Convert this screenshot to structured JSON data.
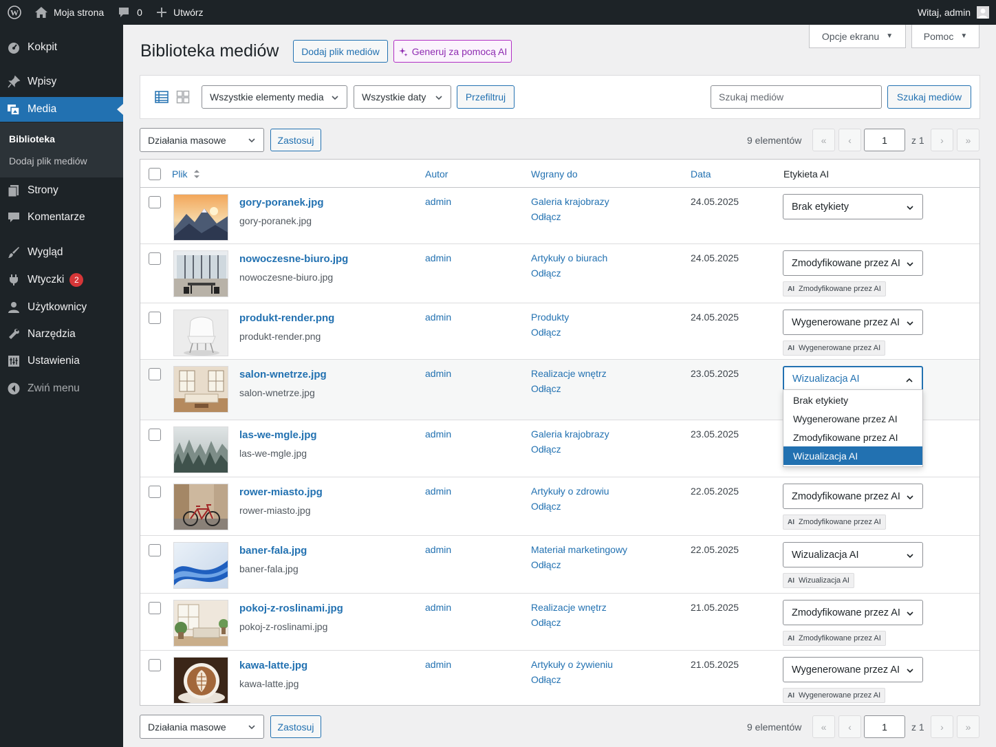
{
  "adminbar": {
    "site_name": "Moja strona",
    "comments_count": "0",
    "new_label": "Utwórz",
    "greeting": "Witaj, admin"
  },
  "sidebar": {
    "items": [
      {
        "label": "Kokpit",
        "icon": "dashboard-icon"
      },
      {
        "label": "Wpisy",
        "icon": "pin-icon"
      },
      {
        "label": "Media",
        "icon": "media-icon"
      },
      {
        "label": "Strony",
        "icon": "pages-icon"
      },
      {
        "label": "Komentarze",
        "icon": "comments-icon"
      },
      {
        "label": "Wygląd",
        "icon": "brush-icon"
      },
      {
        "label": "Wtyczki",
        "icon": "plugin-icon",
        "badge": "2"
      },
      {
        "label": "Użytkownicy",
        "icon": "users-icon"
      },
      {
        "label": "Narzędzia",
        "icon": "tools-icon"
      },
      {
        "label": "Ustawienia",
        "icon": "settings-icon"
      },
      {
        "label": "Zwiń menu",
        "icon": "collapse-icon"
      }
    ],
    "submenu": [
      "Biblioteka",
      "Dodaj plik mediów"
    ]
  },
  "header": {
    "title": "Biblioteka mediów",
    "add_button": "Dodaj plik mediów",
    "ai_button": "Generuj za pomocą AI",
    "screen_options": "Opcje ekranu",
    "help": "Pomoc"
  },
  "filters": {
    "media_type": "Wszystkie elementy media",
    "dates": "Wszystkie daty",
    "filter_button": "Przefiltruj",
    "search_placeholder": "Szukaj mediów",
    "search_button": "Szukaj mediów"
  },
  "bulk": {
    "label": "Działania masowe",
    "apply": "Zastosuj"
  },
  "pagination": {
    "count": "9 elementów",
    "first": "«",
    "prev": "‹",
    "current": "1",
    "of": "z 1",
    "next": "›",
    "last": "»"
  },
  "table": {
    "columns": {
      "file": "Plik",
      "author": "Autor",
      "uploaded_to": "Wgrany do",
      "date": "Data",
      "ai_label": "Etykieta AI"
    },
    "detach": "Odłącz",
    "ai_badge": "AI",
    "rows": [
      {
        "title": "gory-poranek.jpg",
        "file": "gory-poranek.jpg",
        "author": "admin",
        "parent": "Galeria krajobrazy",
        "date": "24.05.2025",
        "ai_label": "Brak etykiety",
        "ai_chip": ""
      },
      {
        "title": "nowoczesne-biuro.jpg",
        "file": "nowoczesne-biuro.jpg",
        "author": "admin",
        "parent": "Artykuły o biurach",
        "date": "24.05.2025",
        "ai_label": "Zmodyfikowane przez AI",
        "ai_chip": "Zmodyfikowane przez AI"
      },
      {
        "title": "produkt-render.png",
        "file": "produkt-render.png",
        "author": "admin",
        "parent": "Produkty",
        "date": "24.05.2025",
        "ai_label": "Wygenerowane przez AI",
        "ai_chip": "Wygenerowane przez AI"
      },
      {
        "title": "salon-wnetrze.jpg",
        "file": "salon-wnetrze.jpg",
        "author": "admin",
        "parent": "Realizacje wnętrz",
        "date": "23.05.2025",
        "ai_label": "Wizualizacja AI",
        "ai_chip": ""
      },
      {
        "title": "las-we-mgle.jpg",
        "file": "las-we-mgle.jpg",
        "author": "admin",
        "parent": "Galeria krajobrazy",
        "date": "23.05.2025",
        "ai_label": "",
        "ai_chip": ""
      },
      {
        "title": "rower-miasto.jpg",
        "file": "rower-miasto.jpg",
        "author": "admin",
        "parent": "Artykuły o zdrowiu",
        "date": "22.05.2025",
        "ai_label": "Zmodyfikowane przez AI",
        "ai_chip": "Zmodyfikowane przez AI"
      },
      {
        "title": "baner-fala.jpg",
        "file": "baner-fala.jpg",
        "author": "admin",
        "parent": "Materiał marketingowy",
        "date": "22.05.2025",
        "ai_label": "Wizualizacja AI",
        "ai_chip": "Wizualizacja AI"
      },
      {
        "title": "pokoj-z-roslinami.jpg",
        "file": "pokoj-z-roslinami.jpg",
        "author": "admin",
        "parent": "Realizacje wnętrz",
        "date": "21.05.2025",
        "ai_label": "Zmodyfikowane przez AI",
        "ai_chip": "Zmodyfikowane przez AI"
      },
      {
        "title": "kawa-latte.jpg",
        "file": "kawa-latte.jpg",
        "author": "admin",
        "parent": "Artykuły o żywieniu",
        "date": "21.05.2025",
        "ai_label": "Wygenerowane przez AI",
        "ai_chip": "Wygenerowane przez AI"
      }
    ]
  },
  "dropdown": {
    "options": [
      "Brak etykiety",
      "Wygenerowane przez AI",
      "Zmodyfikowane przez AI",
      "Wizualizacja AI"
    ],
    "selected": "Wizualizacja AI"
  },
  "colors": {
    "admin_dark": "#1d2327",
    "accent": "#2271b1",
    "ai_purple": "#8e2bb1",
    "badge_red": "#d63638"
  }
}
